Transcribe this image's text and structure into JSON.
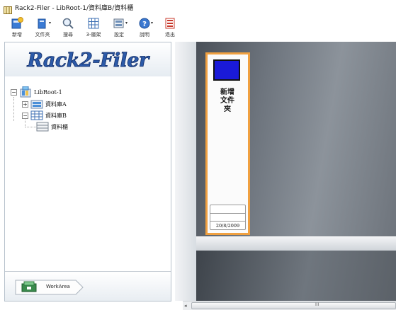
{
  "window": {
    "title": "Rack2-Filer - LibRoot-1/資料庫B/資料櫃"
  },
  "toolbar": {
    "buttons": [
      {
        "icon": "new-icon",
        "label": "新增",
        "has_dropdown": false
      },
      {
        "icon": "folder-icon",
        "label": "文件夾",
        "has_dropdown": true
      },
      {
        "icon": "search-icon",
        "label": "搜尋",
        "has_dropdown": false
      },
      {
        "icon": "grid-icon",
        "label": "3-層架",
        "has_dropdown": false
      },
      {
        "icon": "settings-icon",
        "label": "設定",
        "has_dropdown": true
      },
      {
        "icon": "help-icon",
        "label": "說明",
        "has_dropdown": true
      },
      {
        "icon": "exit-icon",
        "label": "退出",
        "has_dropdown": false
      }
    ]
  },
  "logo": {
    "text": "Rack2-Filer"
  },
  "tree": {
    "root": "LibRoot-1",
    "library_a": "資料庫A",
    "library_b": "資料庫B",
    "cabinet": "資料櫃"
  },
  "workarea": {
    "label": "WorkArea"
  },
  "binder": {
    "title": "新增文件夾",
    "date": "20/8/2009",
    "spine_color": "#1a1ad8",
    "highlight_color": "#f0a040"
  },
  "scrollbar": {
    "grip": "III"
  },
  "colors": {
    "accent": "#f0a040",
    "logo_blue": "#2c5aa8"
  }
}
